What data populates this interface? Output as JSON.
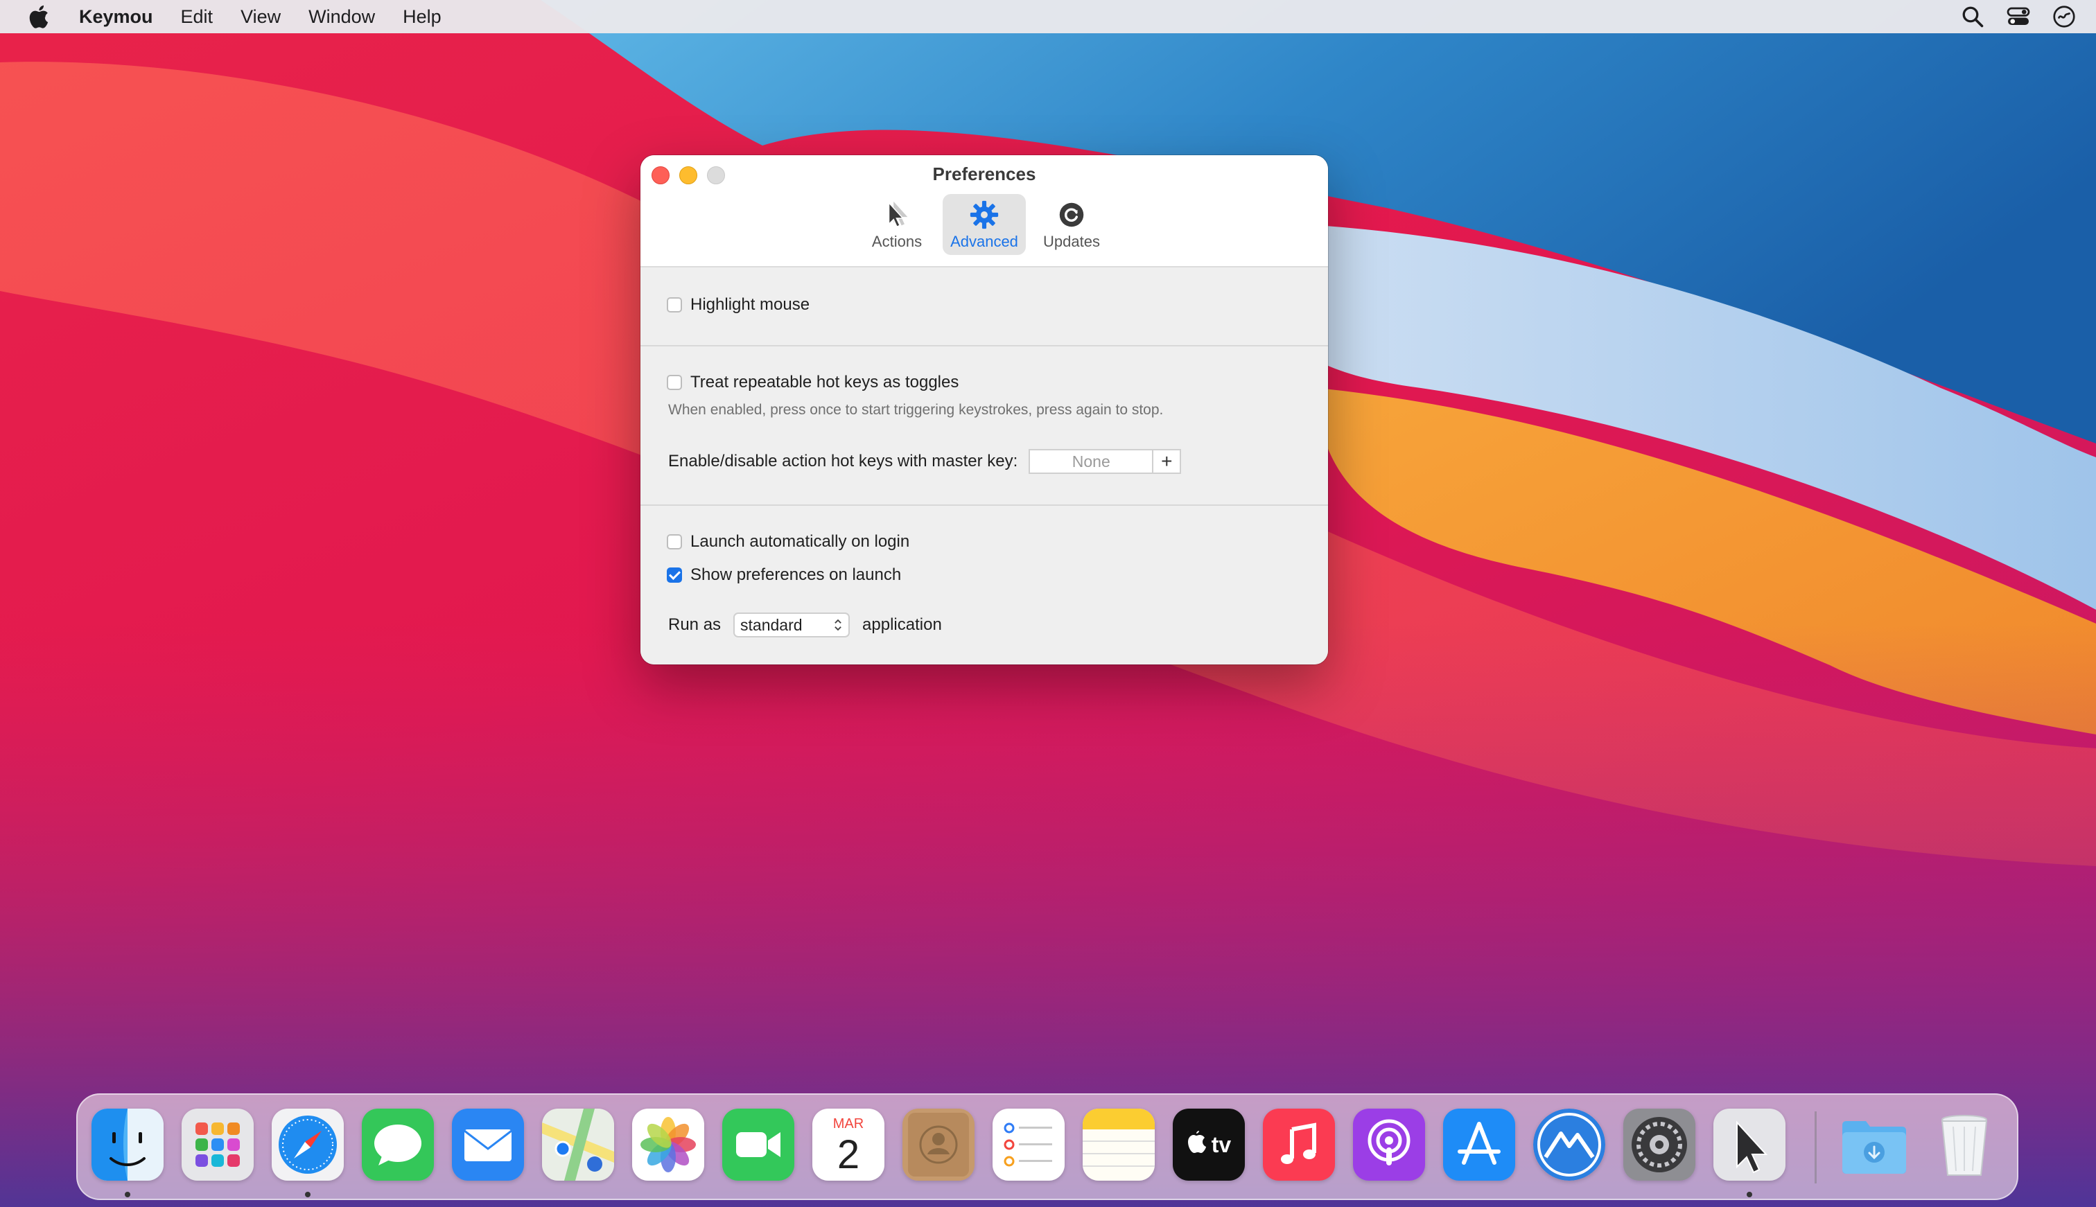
{
  "menubar": {
    "app_name": "Keymou",
    "menus": [
      "Edit",
      "View",
      "Window",
      "Help"
    ],
    "status_icons": [
      "search-icon",
      "control-center-icon",
      "siri-icon"
    ]
  },
  "window": {
    "title": "Preferences",
    "tabs": [
      {
        "label": "Actions",
        "icon": "cursor-icon",
        "selected": false
      },
      {
        "label": "Advanced",
        "icon": "gear-icon",
        "selected": true
      },
      {
        "label": "Updates",
        "icon": "refresh-icon",
        "selected": false
      }
    ],
    "options": {
      "highlight_mouse": {
        "label": "Highlight mouse",
        "checked": false
      },
      "repeatable_toggles": {
        "label": "Treat repeatable hot keys as toggles",
        "checked": false,
        "hint": "When enabled, press once to start triggering keystrokes, press again to stop."
      },
      "master_key": {
        "label": "Enable/disable action hot keys with master key:",
        "value": "None",
        "add_label": "+"
      },
      "launch_login": {
        "label": "Launch automatically on login",
        "checked": false
      },
      "show_prefs": {
        "label": "Show preferences on launch",
        "checked": true
      },
      "run_as": {
        "prefix": "Run as",
        "value": "standard",
        "suffix": "application"
      }
    }
  },
  "dock": {
    "apps": [
      "Finder",
      "Launchpad",
      "Safari",
      "Messages",
      "Mail",
      "Maps",
      "Photos",
      "FaceTime",
      "Calendar",
      "Contacts",
      "Reminders",
      "Notes",
      "TV",
      "Music",
      "Podcasts",
      "App Store",
      "Monterey",
      "System Preferences",
      "Keymou",
      "Downloads",
      "Trash"
    ],
    "calendar": {
      "month": "MAR",
      "day": "2"
    },
    "tv_label": "tv"
  },
  "colors": {
    "accent": "#1a73e8",
    "close": "#fe5f57",
    "minimize": "#febc2e"
  }
}
